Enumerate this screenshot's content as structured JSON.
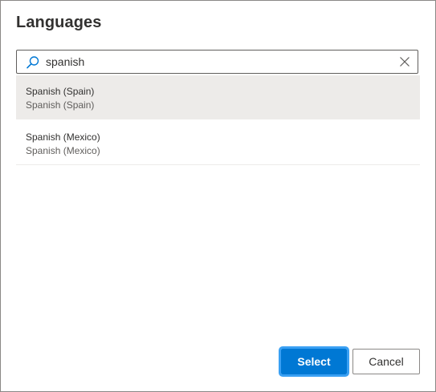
{
  "dialog": {
    "title": "Languages"
  },
  "search": {
    "value": "spanish",
    "icon": "search-icon",
    "clear_icon": "close-icon"
  },
  "results": [
    {
      "primary": "Spanish (Spain)",
      "secondary": "Spanish (Spain)",
      "selected": true
    },
    {
      "primary": "Spanish (Mexico)",
      "secondary": "Spanish (Mexico)",
      "selected": false
    }
  ],
  "footer": {
    "select_label": "Select",
    "cancel_label": "Cancel"
  },
  "colors": {
    "accent": "#0078d4",
    "selected_row": "#edebe9",
    "text": "#323130",
    "secondary_text": "#605e5c"
  }
}
